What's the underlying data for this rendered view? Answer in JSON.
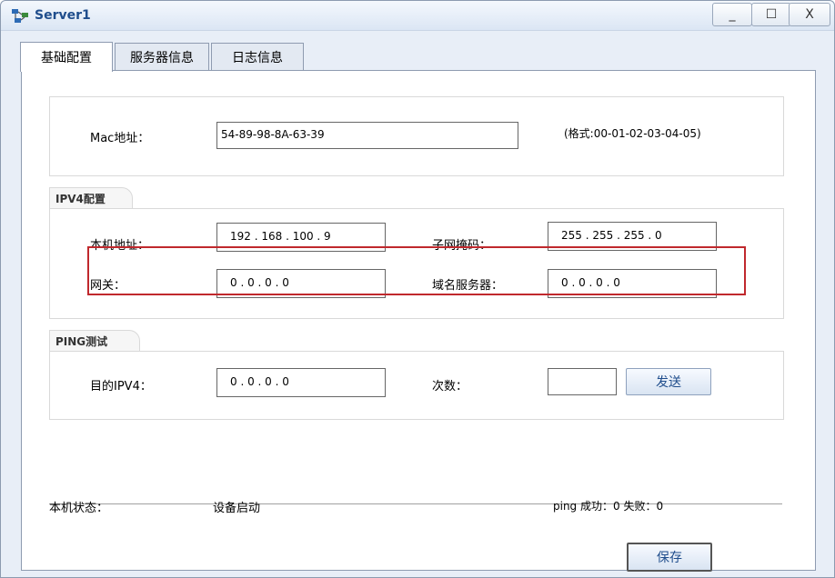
{
  "window": {
    "title": "Server1",
    "minimize": "_",
    "maximize": "☐",
    "close": "X"
  },
  "tabs": [
    {
      "label": "基础配置",
      "active": true
    },
    {
      "label": "服务器信息",
      "active": false
    },
    {
      "label": "日志信息",
      "active": false
    }
  ],
  "mac": {
    "label": "Mac地址：",
    "value": "54-89-98-8A-63-39",
    "hint": "(格式:00-01-02-03-04-05)"
  },
  "ipv4": {
    "section_title": "IPV4配置",
    "host_label": "本机地址：",
    "host_value": "192 . 168 . 100 . 9",
    "mask_label": "子网掩码：",
    "mask_value": "255 . 255 . 255 . 0",
    "gateway_label": "网关：",
    "gateway_value": "0 . 0 . 0 . 0",
    "dns_label": "域名服务器：",
    "dns_value": "0 . 0 . 0 . 0"
  },
  "ping": {
    "section_title": "PING测试",
    "dest_label": "目的IPV4：",
    "dest_value": "0 . 0 . 0 . 0",
    "count_label": "次数：",
    "count_value": "",
    "send_label": "发送"
  },
  "status": {
    "label": "本机状态：",
    "value": "设备启动",
    "ping_result": "ping 成功：0 失败：0"
  },
  "save_label": "保存",
  "colors": {
    "highlight": "#c0282d",
    "title_text": "#1f4d8c",
    "window_bg": "#e8eef7"
  }
}
